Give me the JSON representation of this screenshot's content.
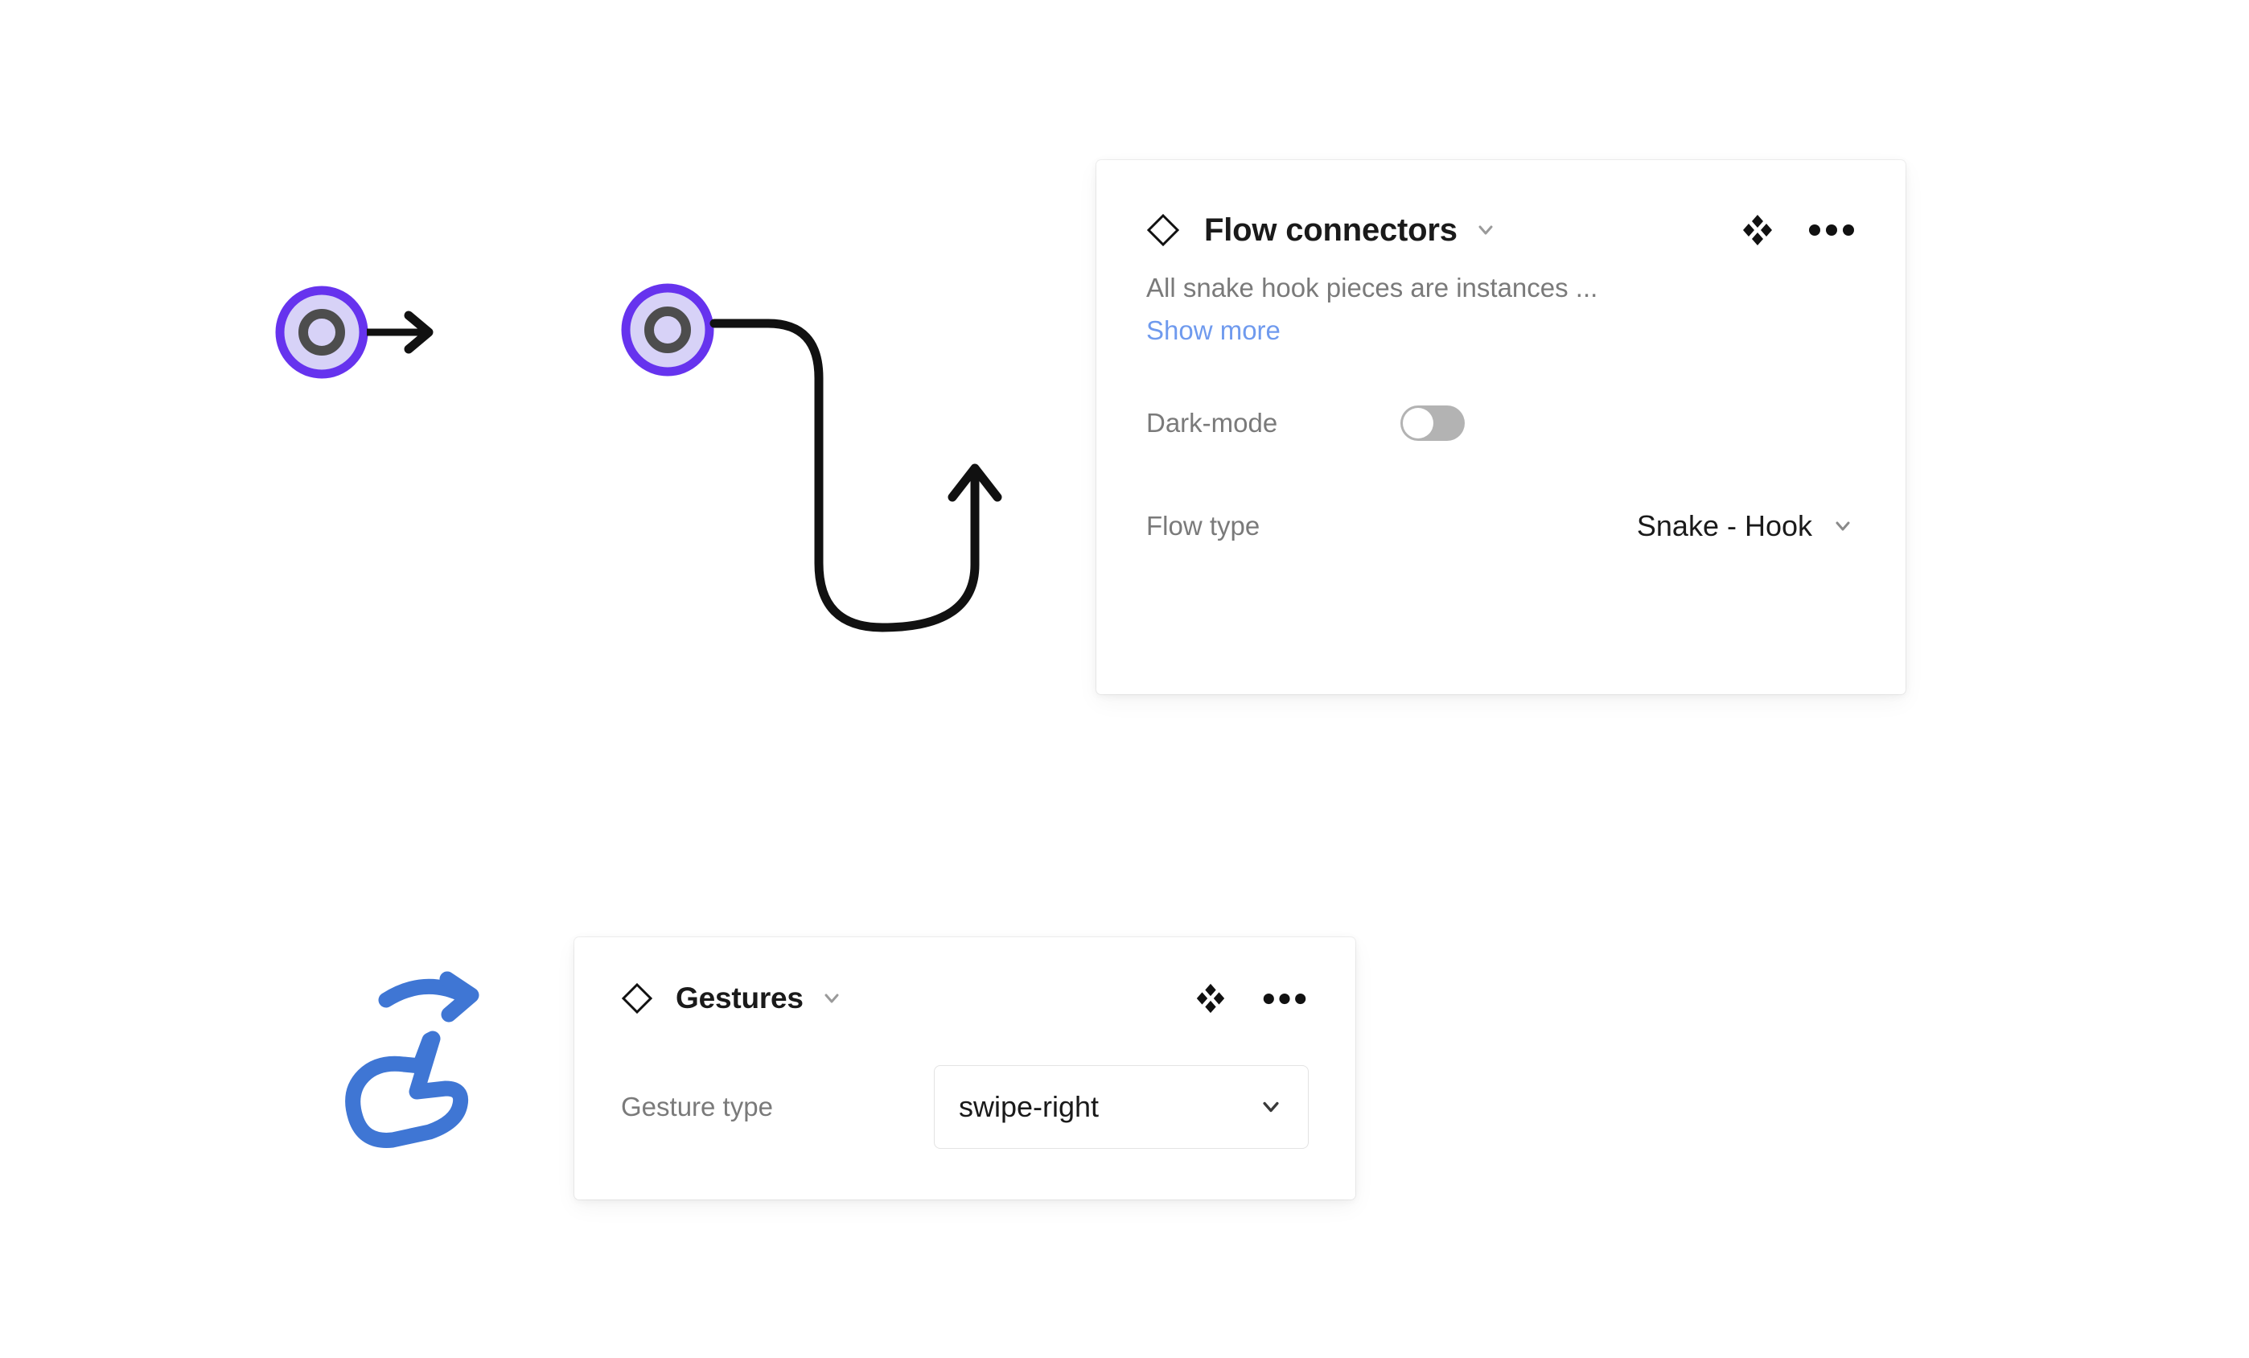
{
  "canvas": {
    "background": "#ffffff",
    "graphics": [
      {
        "name": "straight-flow-connector",
        "description": "Purple node with straight arrow pointing right"
      },
      {
        "name": "snake-hook-flow-connector",
        "description": "Purple node with snake hook curved arrow"
      },
      {
        "name": "swipe-right-gesture-glyph",
        "description": "Blue hand with curved arrow pointing right"
      }
    ]
  },
  "colors": {
    "node_ring": "#6633ee",
    "node_fill": "#d7d2f7",
    "node_inner_ring": "#4d4d4d",
    "connector_stroke": "#111111",
    "gesture_blue": "#3f76d4",
    "link_blue": "#6f9aee",
    "label_gray": "#7a7a7a",
    "value_black": "#1a1a1a",
    "toggle_track": "#b3b3b3",
    "panel_border": "#e3e3e3"
  },
  "panels": [
    {
      "id": "flow-connectors",
      "header": {
        "component_icon": "diamond-icon",
        "title": "Flow connectors",
        "chevron": "chevron-down-icon",
        "swap_icon": "swap-instance-icon",
        "more_icon": "more-options-icon"
      },
      "description": {
        "text": "All snake hook pieces are instances ...",
        "show_more_label": "Show more"
      },
      "rows": [
        {
          "label": "Dark-mode",
          "control": "toggle",
          "value": "off"
        },
        {
          "label": "Flow type",
          "control": "select",
          "value": "Snake - Hook",
          "chevron": "chevron-down-icon"
        }
      ]
    },
    {
      "id": "gestures",
      "header": {
        "component_icon": "diamond-icon",
        "title": "Gestures",
        "chevron": "chevron-down-icon",
        "swap_icon": "swap-instance-icon",
        "more_icon": "more-options-icon"
      },
      "rows": [
        {
          "label": "Gesture type",
          "control": "select-box",
          "value": "swipe-right",
          "chevron": "chevron-down-icon"
        }
      ]
    }
  ]
}
